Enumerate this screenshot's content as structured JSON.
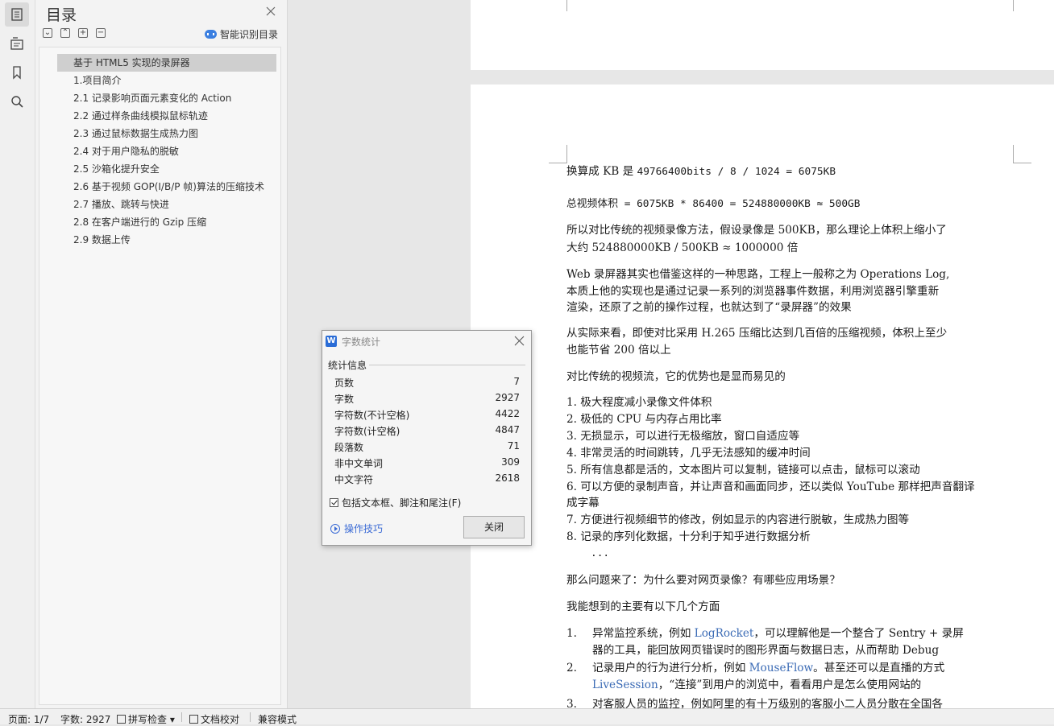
{
  "toc": {
    "title": "目录",
    "smart_toc_label": "智能识别目录",
    "items": [
      "基于 HTML5 实现的录屏器",
      "1.项目简介",
      "2.1 记录影响页面元素变化的 Action",
      "2.2 通过样条曲线模拟鼠标轨迹",
      "2.3 通过鼠标数据生成热力图",
      "2.4 对于用户隐私的脱敏",
      "2.5 沙箱化提升安全",
      "2.6 基于视频 GOP(I/B/P 帧)算法的压缩技术",
      "2.7 播放、跳转与快进",
      "2.8 在客户端进行的 Gzip 压缩",
      "2.9 数据上传"
    ]
  },
  "dialog": {
    "title": "字数统计",
    "section": "统计信息",
    "stats": [
      {
        "label": "页数",
        "value": "7"
      },
      {
        "label": "字数",
        "value": "2927"
      },
      {
        "label": "字符数(不计空格)",
        "value": "4422"
      },
      {
        "label": "字符数(计空格)",
        "value": "4847"
      },
      {
        "label": "段落数",
        "value": "71"
      },
      {
        "label": "非中文单词",
        "value": "309"
      },
      {
        "label": "中文字符",
        "value": "2618"
      }
    ],
    "checkbox_label": "包括文本框、脚注和尾注(F)",
    "tips_label": "操作技巧",
    "close_label": "关闭"
  },
  "document": {
    "kb_line_prefix": "换算成 KB 是 ",
    "kb_line_formula": "49766400bits / 8 / 1024 = 6075KB",
    "total_line": "总视频体积 = 6075KB * 86400 = 524880000KB ≈ 500GB",
    "p1_l1": "所以对比传统的视频录像方法，假设录像是 500KB，那么理论上体积上缩小了",
    "p1_l2": "大约  524880000KB / 500KB ≈ 1000000 倍",
    "p2_l1": "Web 录屏器其实也借鉴这样的一种思路，工程上一般称之为 Operations Log,",
    "p2_l2": "本质上他的实现也是通过记录一系列的浏览器事件数据，利用浏览器引擎重新",
    "p2_l3": "渲染，还原了之前的操作过程，也就达到了“录屏器”的效果",
    "p3_l1": "从实际来看，即使对比采用 H.265 压缩比达到几百倍的压缩视频，体积上至少",
    "p3_l2": "也能节省 200 倍以上",
    "p4": "对比传统的视频流，它的优势也是显而易见的",
    "adv": [
      "1. 极大程度减小录像文件体积",
      "2. 极低的 CPU 与内存占用比率",
      "3. 无损显示，可以进行无极缩放，窗口自适应等",
      "4. 非常灵活的时间跳转，几乎无法感知的缓冲时间",
      "5. 所有信息都是活的，文本图片可以复制，链接可以点击，鼠标可以滚动",
      "6. 可以方便的录制声音，并让声音和画面同步，还以类似 YouTube 那样把声音翻译",
      "成字幕",
      "7. 方便进行视频细节的修改，例如显示的内容进行脱敏，生成热力图等",
      "8. 记录的序列化数据，十分利于知乎进行数据分析",
      "..."
    ],
    "q": "那么问题来了：为什么要对网页录像？有哪些应用场景？",
    "q2": "我能想到的主要有以下几个方面",
    "s1_num": "1.",
    "s1_l1_a": "异常监控系统，例如 ",
    "s1_l1_link": "LogRocket",
    "s1_l1_b": "，可以理解他是一个整合了 Sentry + 录屏",
    "s1_l2": "器的工具，能回放网页错误时的图形界面与数据日志，从而帮助 Debug",
    "s2_num": "2.",
    "s2_l1_a": "记录用户的行为进行分析，例如 ",
    "s2_l1_link": "MouseFlow",
    "s2_l1_b": "。甚至还可以是直播的方式",
    "s2_l2_link": "LiveSession",
    "s2_l2_b": "，“连接”到用户的浏览中，看看用户是怎么使用网站的",
    "s3_num": "3.",
    "s3_l1": "对客服人员的监控，例如阿里的有十万级别的客服小二人员分散在全国各"
  },
  "status": {
    "page": "页面: 1/7",
    "words": "字数: 2927",
    "spell": "拼写检查",
    "doc_check": "文档校对",
    "compat": "兼容模式"
  }
}
